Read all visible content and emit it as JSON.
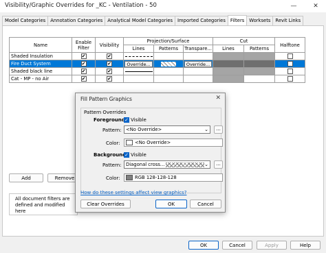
{
  "window": {
    "title": "Visibility/Graphic Overrides for _KC - Ventilation - 50",
    "minimize": "—",
    "close": "✕"
  },
  "tabs": [
    {
      "label": "Model Categories"
    },
    {
      "label": "Annotation Categories"
    },
    {
      "label": "Analytical Model Categories"
    },
    {
      "label": "Imported Categories"
    },
    {
      "label": "Filters"
    },
    {
      "label": "Worksets"
    },
    {
      "label": "Revit Links"
    }
  ],
  "grid": {
    "headers": {
      "name": "Name",
      "enable_filter": "Enable Filter",
      "visibility": "Visibility",
      "projection_surface": "Projection/Surface",
      "cut": "Cut",
      "halftone": "Halftone",
      "lines": "Lines",
      "patterns": "Patterns",
      "transparency": "Transpare...",
      "cut_lines": "Lines",
      "cut_patterns": "Patterns"
    },
    "rows": [
      {
        "name": "Shaded Insulation",
        "enable_filter": true,
        "visibility": true,
        "line_style": "dashed",
        "halftone": false,
        "selected": false
      },
      {
        "name": "Fire Duct System",
        "enable_filter": true,
        "visibility": true,
        "lines_button": "Override...",
        "transparency_button": "Override...",
        "halftone": false,
        "selected": true
      },
      {
        "name": "Shaded black line",
        "enable_filter": true,
        "visibility": true,
        "line_style": "solid",
        "halftone": false,
        "selected": false
      },
      {
        "name": "Cat - MP - no Air",
        "enable_filter": true,
        "visibility": true,
        "halftone": false,
        "selected": false
      }
    ]
  },
  "bottom": {
    "add_label": "Add",
    "remove_label": "Remove",
    "info_text": "All document filters are defined and modified here"
  },
  "footer": {
    "ok": "OK",
    "cancel": "Cancel",
    "apply": "Apply",
    "help": "Help"
  },
  "dialog": {
    "title": "Fill Pattern Graphics",
    "close": "✕",
    "group_label": "Pattern Overrides",
    "foreground": {
      "heading": "Foreground",
      "visible_label": "Visible",
      "pattern_label": "Pattern:",
      "pattern_value": "<No Override>",
      "color_label": "Color:",
      "color_value": "<No Override>",
      "color_hex": "#ffffff"
    },
    "background": {
      "heading": "Background",
      "visible_label": "Visible",
      "pattern_label": "Pattern:",
      "pattern_value": "Diagonal cross...",
      "color_label": "Color:",
      "color_value": "RGB 128-128-128",
      "color_hex": "#808080"
    },
    "ellipsis": "...",
    "help_link": "How do these settings affect view graphics?",
    "clear_label": "Clear Overrides",
    "ok_label": "OK",
    "cancel_label": "Cancel"
  },
  "colors": {
    "selection": "#0078d7",
    "accent": "#0a64c8",
    "cut_grey": "#a5a5a5"
  }
}
